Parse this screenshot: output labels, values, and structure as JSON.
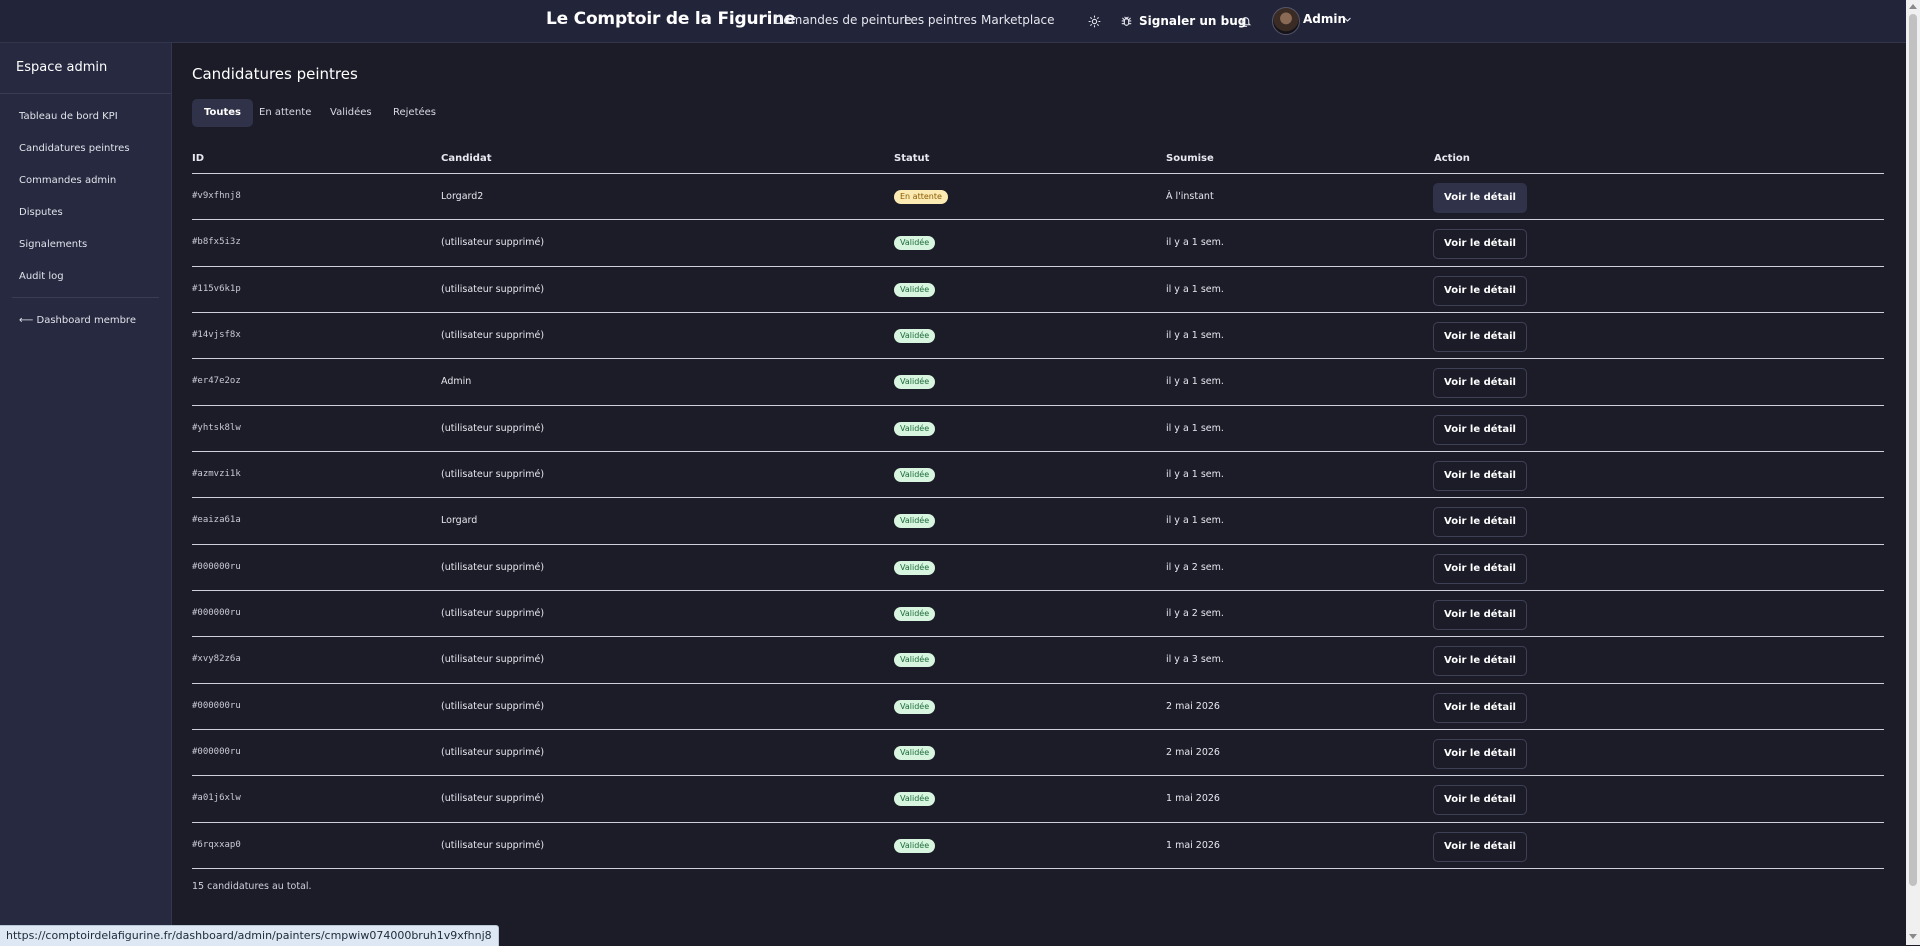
{
  "header": {
    "brand": "Le Comptoir de la Figurine",
    "nav": [
      "Demandes de peinture",
      "Les peintres",
      "Marketplace"
    ],
    "bug_label": "Signaler un bug",
    "user_name": "Admin"
  },
  "sidebar": {
    "title": "Espace admin",
    "items": [
      "Tableau de bord KPI",
      "Candidatures peintres",
      "Commandes admin",
      "Disputes",
      "Signalements",
      "Audit log"
    ],
    "back_link": "⟵ Dashboard membre"
  },
  "main": {
    "title": "Candidatures peintres",
    "tabs": [
      "Toutes",
      "En attente",
      "Validées",
      "Rejetées"
    ],
    "active_tab": "Toutes",
    "columns": [
      "ID",
      "Candidat",
      "Statut",
      "Soumise",
      "Action"
    ],
    "action_label": "Voir le détail",
    "rows": [
      {
        "id": "#v9xfhnj8",
        "candidate": "Lorgard2",
        "status": "En attente",
        "status_type": "pending",
        "submitted": "À l'instant"
      },
      {
        "id": "#b8fx5i3z",
        "candidate": "(utilisateur supprimé)",
        "status": "Validée",
        "status_type": "valid",
        "submitted": "il y a 1 sem."
      },
      {
        "id": "#115v6k1p",
        "candidate": "(utilisateur supprimé)",
        "status": "Validée",
        "status_type": "valid",
        "submitted": "il y a 1 sem."
      },
      {
        "id": "#14vjsf8x",
        "candidate": "(utilisateur supprimé)",
        "status": "Validée",
        "status_type": "valid",
        "submitted": "il y a 1 sem."
      },
      {
        "id": "#er47e2oz",
        "candidate": "Admin",
        "status": "Validée",
        "status_type": "valid",
        "submitted": "il y a 1 sem."
      },
      {
        "id": "#yhtsk8lw",
        "candidate": "(utilisateur supprimé)",
        "status": "Validée",
        "status_type": "valid",
        "submitted": "il y a 1 sem."
      },
      {
        "id": "#azmvzi1k",
        "candidate": "(utilisateur supprimé)",
        "status": "Validée",
        "status_type": "valid",
        "submitted": "il y a 1 sem."
      },
      {
        "id": "#eaiza61a",
        "candidate": "Lorgard",
        "status": "Validée",
        "status_type": "valid",
        "submitted": "il y a 1 sem."
      },
      {
        "id": "#000000ru",
        "candidate": "(utilisateur supprimé)",
        "status": "Validée",
        "status_type": "valid",
        "submitted": "il y a 2 sem."
      },
      {
        "id": "#000000ru",
        "candidate": "(utilisateur supprimé)",
        "status": "Validée",
        "status_type": "valid",
        "submitted": "il y a 2 sem."
      },
      {
        "id": "#xvy82z6a",
        "candidate": "(utilisateur supprimé)",
        "status": "Validée",
        "status_type": "valid",
        "submitted": "il y a 3 sem."
      },
      {
        "id": "#000000ru",
        "candidate": "(utilisateur supprimé)",
        "status": "Validée",
        "status_type": "valid",
        "submitted": "2 mai 2026"
      },
      {
        "id": "#000000ru",
        "candidate": "(utilisateur supprimé)",
        "status": "Validée",
        "status_type": "valid",
        "submitted": "2 mai 2026"
      },
      {
        "id": "#a01j6xlw",
        "candidate": "(utilisateur supprimé)",
        "status": "Validée",
        "status_type": "valid",
        "submitted": "1 mai 2026"
      },
      {
        "id": "#6rqxxap0",
        "candidate": "(utilisateur supprimé)",
        "status": "Validée",
        "status_type": "valid",
        "submitted": "1 mai 2026"
      }
    ],
    "total_text": "15 candidatures au total."
  },
  "statusbar": {
    "url": "https://comptoirdelafigurine.fr/dashboard/admin/painters/cmpwiw074000bruh1v9xfhnj8"
  },
  "icons": {
    "theme": "sun-icon",
    "bug": "bug-icon",
    "notifications": "bell-icon",
    "user_menu": "chevron-down-icon"
  }
}
